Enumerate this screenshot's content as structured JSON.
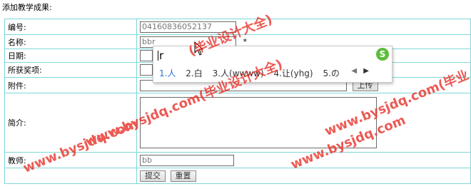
{
  "page": {
    "title": "添加教学成果:"
  },
  "form": {
    "id_label": "编号:",
    "id_value": "04160836052137",
    "name_label": "名称:",
    "name_value": "bbr",
    "name_required": "*",
    "date_label": "日期:",
    "date_value": "",
    "award_label": "所获奖项:",
    "award_value": "",
    "attachment_label": "附件:",
    "attachment_value": "",
    "upload_label": "上传",
    "intro_label": "简介:",
    "intro_value": "",
    "teacher_label": "教师:",
    "teacher_value": "bb",
    "submit_label": "提交",
    "reset_label": "重置"
  },
  "ime": {
    "input_text": "r",
    "logo": "S",
    "candidates": [
      "1.人",
      "2.白",
      "3.人(wwww)",
      "4.让(yhg)",
      "5.の"
    ],
    "prev_arrow": "◀",
    "next_arrow": "▶"
  },
  "watermark": {
    "text_url": "www.bysjdq.com",
    "text_brand": "(毕业设计大全)",
    "color": "#e8322a"
  }
}
